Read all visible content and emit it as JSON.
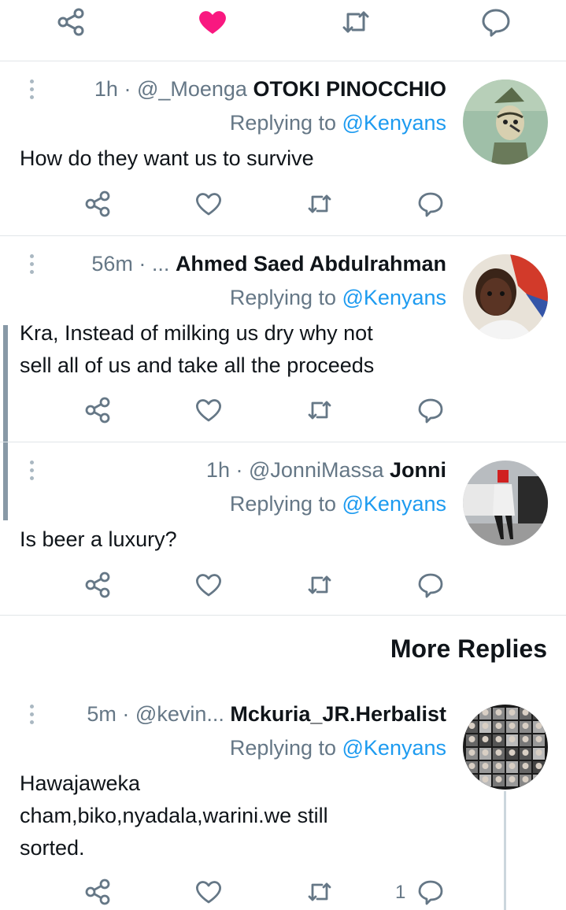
{
  "colors": {
    "accent": "#1d9bf0",
    "like": "#f91880",
    "muted": "#657786",
    "divider": "#e1e5e8"
  },
  "icons": {
    "share": "share-icon",
    "like": "heart-icon",
    "retweet": "retweet-icon",
    "reply": "reply-icon",
    "more": "more-dots-icon"
  },
  "top_actions": {
    "liked": true
  },
  "more_replies_label": "More Replies",
  "replies": [
    {
      "time": "1h",
      "sep": "·",
      "handle": "@_Moenga",
      "name": "OTOKI PINOCCHIO",
      "replying_prefix": "Replying to ",
      "replying_handle": "@Kenyans",
      "text": "How do they want us to survive"
    },
    {
      "time": "56m",
      "sep": "·",
      "handle": "...",
      "name": "Ahmed Saed Abdulrahman",
      "replying_prefix": "Replying to ",
      "replying_handle": "@Kenyans",
      "text_lines": [
        "Kra, Instead of milking us dry why not",
        "sell all of  us and take all the proceeds"
      ]
    },
    {
      "time": "1h",
      "sep": "·",
      "handle": "@JonniMassa",
      "name": "Jonni",
      "replying_prefix": "Replying to ",
      "replying_handle": "@Kenyans",
      "text": "Is beer a luxury?"
    },
    {
      "time": "5m",
      "sep": "·",
      "handle": "@kevin...",
      "name": "Mckuria_JR.Herbalist",
      "replying_prefix": "Replying to ",
      "replying_handle": "@Kenyans",
      "text_lines": [
        "Hawajaweka",
        "cham,biko,nyadala,warini.we still",
        "sorted."
      ],
      "reply_count": "1"
    }
  ]
}
